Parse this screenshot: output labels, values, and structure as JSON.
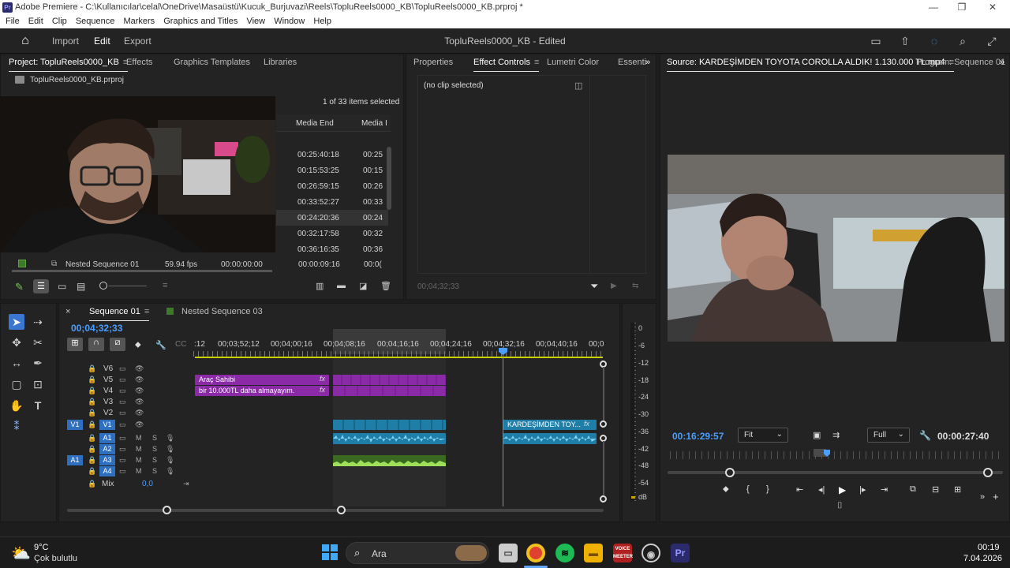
{
  "window": {
    "title": "Adobe Premiere - C:\\Kullanıcılar\\celal\\OneDrive\\Masaüstü\\Kucuk_Burjuvazi\\Reels\\TopluReels0000_KB\\TopluReels0000_KB.prproj *",
    "app_badge": "Pr"
  },
  "menu": [
    "File",
    "Edit",
    "Clip",
    "Sequence",
    "Markers",
    "Graphics and Titles",
    "View",
    "Window",
    "Help"
  ],
  "header": {
    "import_label": "Import",
    "edit_label": "Edit",
    "export_label": "Export",
    "project_title": "TopluReels0000_KB - Edited"
  },
  "project_panel": {
    "tabs": [
      "Project: TopluReels0000_KB",
      "Effects",
      "Graphics Templates",
      "Libraries"
    ],
    "file_name": "TopluReels0000_KB.prproj",
    "selection_count": "1 of 33 items selected",
    "columns": [
      "Media End",
      "Media I"
    ],
    "rows": [
      {
        "end": "00:25:40:18",
        "dur": "00:25"
      },
      {
        "end": "00:15:53:25",
        "dur": "00:15"
      },
      {
        "end": "00:26:59:15",
        "dur": "00:26"
      },
      {
        "end": "00:33:52:27",
        "dur": "00:33"
      },
      {
        "end": "00:24:20:36",
        "dur": "00:24"
      },
      {
        "end": "00:32:17:58",
        "dur": "00:32"
      },
      {
        "end": "00:36:16:35",
        "dur": "00:36"
      }
    ],
    "nested_row": {
      "name": "Nested Sequence 01",
      "fps": "59.94 fps",
      "start": "00:00:00:00",
      "end": "00:00:09:16",
      "dur": "00:0("
    }
  },
  "effect_panel": {
    "tabs": [
      "Properties",
      "Effect Controls",
      "Lumetri Color",
      "Essenti"
    ],
    "no_clip": "(no clip selected)",
    "timecode": "00;04;32;33"
  },
  "source_panel": {
    "source_tab": "Source: KARDEŞİMDEN TOYOTA COROLLA ALDIK! 1.130.000 TL.mp4",
    "program_tab": "Program: Sequence 01",
    "timecode_in": "00:16:29:57",
    "fit_label": "Fit",
    "full_label": "Full",
    "duration": "00:00:27:40"
  },
  "timeline": {
    "tabs": [
      "Sequence 01",
      "Nested Sequence 03"
    ],
    "current_time": "00;04;32;33",
    "ruler": ":12|00;03;52;12|00;04;00;16|00;04;08;16|00;04;16;16|00;04;24;16|00;04;32;16|00;04;40;16|00;0",
    "video_tracks": [
      "V6",
      "V5",
      "V4",
      "V3",
      "V2",
      "V1"
    ],
    "audio_tracks": [
      "A1",
      "A2",
      "A3",
      "A4"
    ],
    "src_v": "V1",
    "src_a": "A1",
    "mix_label": "Mix",
    "mix_value": "0,0",
    "clips": {
      "v5": "Araç Sahibi",
      "v4": "bir 10.000TL daha almayayım.",
      "v1_right": "KARDEŞİMDEN TOY...",
      "fx": "fx"
    },
    "m": "M",
    "s": "S"
  },
  "meters": {
    "scale": [
      "0",
      "-6",
      "-12",
      "-18",
      "-24",
      "-30",
      "-36",
      "-42",
      "-48",
      "-54",
      "dB"
    ]
  },
  "taskbar": {
    "temp": "9°C",
    "weather": "Çok bulutlu",
    "search": "Ara",
    "time": "00:19",
    "date": "7.04.2026",
    "voice_badge": "VOICE MEETER",
    "pr_badge": "Pr"
  }
}
